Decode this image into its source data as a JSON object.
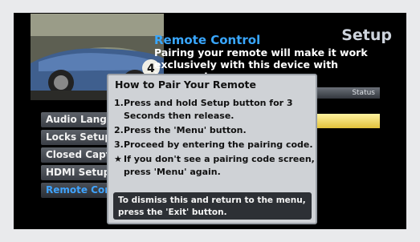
{
  "header": {
    "section_title": "Setup",
    "title": "Remote Control",
    "description": "Pairing your remote will make it work exclusively with this device with improved"
  },
  "status": {
    "label": "Status"
  },
  "menu": {
    "items": [
      {
        "label": "Audio Language"
      },
      {
        "label": "Locks Setup"
      },
      {
        "label": "Closed Captions"
      },
      {
        "label": "HDMI Setup"
      },
      {
        "label": "Remote Control"
      }
    ]
  },
  "popup": {
    "title": "How to Pair Your Remote",
    "steps": [
      {
        "marker": "1.",
        "text": "Press and hold Setup button for 3 Seconds then release."
      },
      {
        "marker": "2.",
        "text": "Press the 'Menu' button."
      },
      {
        "marker": "3.",
        "text": "Proceed by entering the pairing code."
      },
      {
        "marker": "★",
        "text": "If you don't see a pairing code screen, press 'Menu' again."
      }
    ],
    "dismiss": "To dismiss this and return to the menu, press the 'Exit' button."
  },
  "colors": {
    "accent": "#39a7ff",
    "status_fill": "#e8c84a",
    "popup_bg": "#cfd2d6",
    "dismiss_bg": "#2d3035"
  }
}
